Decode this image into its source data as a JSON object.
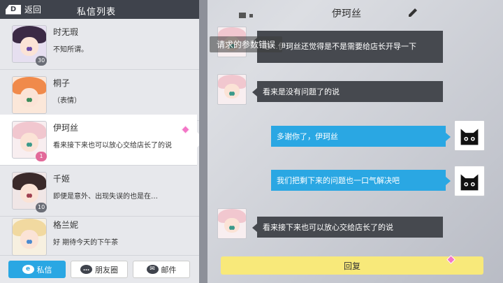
{
  "header": {
    "back_label": "返回",
    "back_icon": "D",
    "list_title": "私信列表"
  },
  "conversations": [
    {
      "name": "时无瑕",
      "preview": "不知所谓。",
      "level": "30",
      "hair": "#3b2a45",
      "eye": "#6a4aa8"
    },
    {
      "name": "桐子",
      "preview": "（表情）",
      "level": "",
      "hair": "#f08a4b",
      "eye": "#3c8c5a"
    },
    {
      "name": "伊珂丝",
      "preview": "看来接下来也可以放心交给店长了的说",
      "level": "1",
      "hair": "#f1c7cf",
      "eye": "#3a9a8a"
    },
    {
      "name": "千姬",
      "preview": "即便是意外、出现失误的也是在…",
      "level": "10",
      "hair": "#3a2a2a",
      "eye": "#a04050"
    },
    {
      "name": "格兰妮",
      "preview": "好 期待今天的下午茶",
      "level": "",
      "hair": "#f1d9a0",
      "eye": "#4a8ad0"
    }
  ],
  "tabs": {
    "messages": "私信",
    "messages_icon": "e",
    "moments": "朋友圈",
    "moments_icon": "…",
    "mail": "邮件",
    "mail_icon": "✉"
  },
  "chat": {
    "title": "伊珂丝",
    "messages": [
      {
        "side": "left",
        "text": "嗯…伊珂丝还觉得是不是需要给店长开导一下"
      },
      {
        "side": "left",
        "text": "看来是没有问题了的说"
      },
      {
        "side": "right",
        "text": "多谢你了，伊珂丝"
      },
      {
        "side": "right",
        "text": "我们把剩下来的问题也一口气解决吧"
      },
      {
        "side": "left",
        "text": "看来接下来也可以放心交给店长了的说"
      }
    ],
    "reply_label": "回复"
  },
  "toast": "请求的参数错误",
  "colors": {
    "accent": "#2aa7e3",
    "reply": "#f8e97a",
    "dark_bubble": "#46494f",
    "highlight": "#f377c7"
  }
}
